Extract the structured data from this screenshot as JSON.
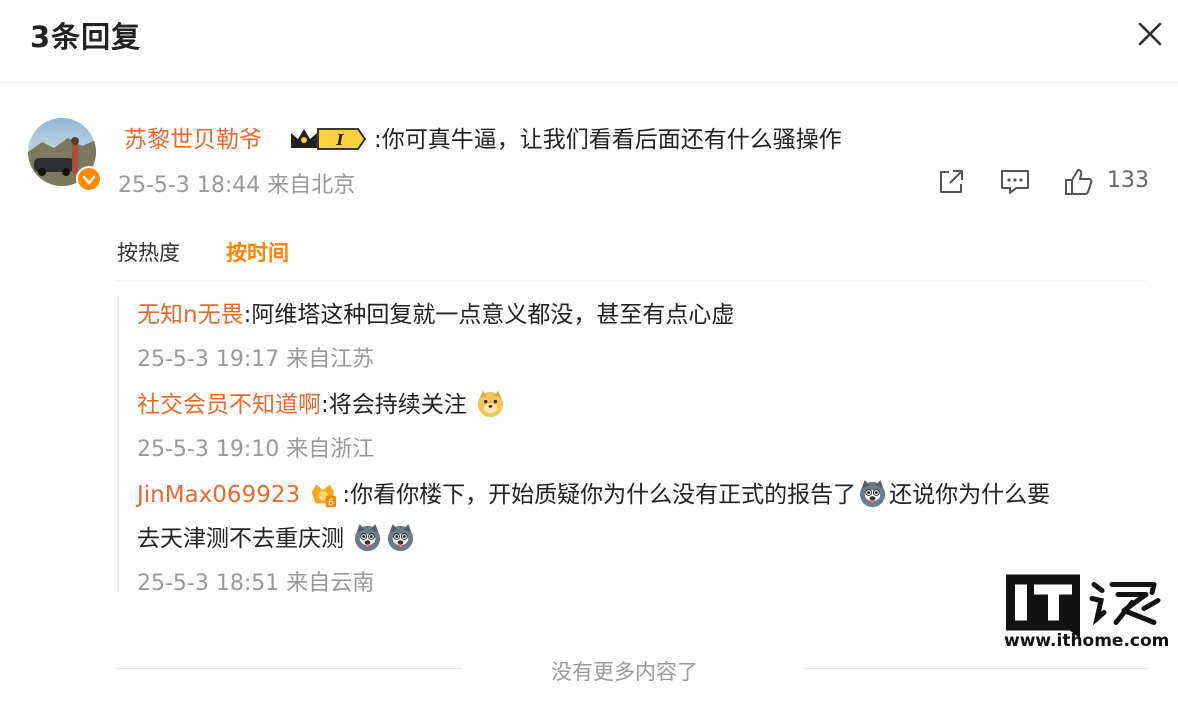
{
  "header": {
    "title": "3条回复"
  },
  "main_comment": {
    "username": "苏黎世贝勒爷",
    "vip_badge_text": "I",
    "text": ":你可真牛逼，让我们看看后面还有什么骚操作",
    "meta": "25-5-3 18:44 来自北京",
    "like_count": "133"
  },
  "sort_tabs": {
    "hot": "按热度",
    "time": "按时间"
  },
  "replies": [
    {
      "username": "无知n无畏",
      "text": ":阿维塔这种回复就一点意义都没，甚至有点心虚",
      "meta": "25-5-3 19:17 来自江苏"
    },
    {
      "username": "社交会员不知道啊",
      "text": ":将会持续关注",
      "meta": "25-5-3 19:10 来自浙江"
    },
    {
      "username": "JinMax069923",
      "badge_level": "6",
      "text_a": ":你看你楼下，开始质疑你为什么没有正式的报告了",
      "text_b": "还说你为什么要",
      "text_c": "去天津测不去重庆测",
      "meta": "25-5-3 18:51 来自云南"
    }
  ],
  "footer": {
    "text": "没有更多内容了"
  },
  "watermark": {
    "logo": "IT之家",
    "url": "www.ithome.com"
  },
  "colors": {
    "username": "#e86a2f",
    "active_tab": "#ff8200",
    "meta": "#999999"
  }
}
